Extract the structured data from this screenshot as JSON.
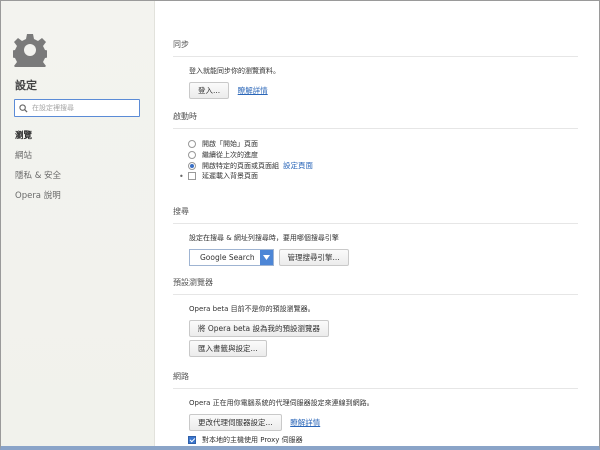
{
  "sidebar": {
    "title": "設定",
    "search_placeholder": "在設定裡搜尋",
    "items": [
      {
        "label": "瀏覽",
        "active": true
      },
      {
        "label": "網站",
        "active": false
      },
      {
        "label": "隱私 & 安全",
        "active": false
      },
      {
        "label": "Opera 說明",
        "active": false
      }
    ]
  },
  "sync": {
    "heading": "同步",
    "description": "登入就能同步你的瀏覽資料。",
    "login_label": "登入...",
    "learn_more": "瞭解詳情"
  },
  "startup": {
    "heading": "啟動時",
    "options": [
      {
        "label": "開啟「開始」頁面",
        "selected": false
      },
      {
        "label": "繼續從上次的進度",
        "selected": false
      },
      {
        "label": "開啟特定的頁面或頁面組",
        "selected": true,
        "link": "設定頁面"
      }
    ],
    "delay_label": "延遲載入背景頁面",
    "delay_checked": false
  },
  "search": {
    "heading": "搜尋",
    "description": "設定在搜尋 & 網址列搜尋時，要用哪個搜尋引擎",
    "engine": "Google Search",
    "manage_label": "管理搜尋引擎..."
  },
  "default_browser": {
    "heading": "預設瀏覽器",
    "description": "Opera beta 目前不是你的預設瀏覽器。",
    "make_default_label": "將 Opera beta 設為我的預設瀏覽器",
    "import_label": "匯入書籤與設定..."
  },
  "network": {
    "heading": "網路",
    "description": "Opera 正在用你電腦系統的代理伺服器設定來連線到網路。",
    "change_proxy_label": "更改代理伺服器設定...",
    "learn_more": "瞭解詳情",
    "local_proxy_label": "對本地的主機使用 Proxy 伺服器",
    "local_proxy_checked": true
  },
  "colors": {
    "accent": "#4d86d6",
    "link": "#2a66b8"
  }
}
